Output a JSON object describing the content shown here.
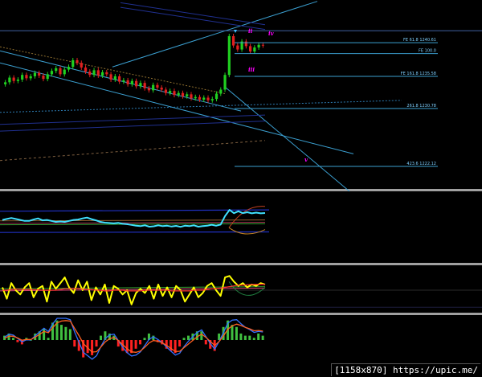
{
  "chart_data": [
    {
      "type": "candlestick",
      "panel": "price",
      "candles_close": [
        1234.7,
        1235.4,
        1234.9,
        1235.1,
        1235.8,
        1235.3,
        1235.6,
        1236.1,
        1235.7,
        1235.2,
        1235.9,
        1236.4,
        1236.8,
        1235.9,
        1236.6,
        1237.0,
        1238.0,
        1237.6,
        1236.9,
        1236.3,
        1235.8,
        1236.5,
        1235.7,
        1236.2,
        1235.9,
        1235.1,
        1235.6,
        1234.8,
        1235.0,
        1234.4,
        1234.9,
        1234.1,
        1234.6,
        1233.8,
        1233.5,
        1234.3,
        1233.9,
        1233.6,
        1233.1,
        1233.4,
        1232.8,
        1233.1,
        1232.6,
        1232.9,
        1232.3,
        1232.5,
        1232.1,
        1232.4,
        1232.0,
        1232.2,
        1233.0,
        1233.6,
        1235.8,
        1241.6,
        1240.2,
        1239.6,
        1240.8,
        1240.1,
        1239.3,
        1239.9,
        1240.3,
        1240.2
      ],
      "levels": [
        {
          "label": "FE 61.8 1240.61",
          "value": 1240.61
        },
        {
          "label": "FE 100.0",
          "value": 1239.0
        },
        {
          "label": "FE 161.8 1235.58",
          "value": 1235.58
        },
        {
          "label": "261.8 1230.78",
          "value": 1230.78
        },
        {
          "label": "423.6 1222.12",
          "value": 1222.12
        }
      ],
      "wave_labels": [
        {
          "text": "ii",
          "color": "#ff00ff"
        },
        {
          "text": "iii",
          "color": "#ff00ff"
        },
        {
          "text": "iv",
          "color": "#ff00ff"
        },
        {
          "text": "v",
          "color": "#ff00ff"
        }
      ],
      "ylim": [
        1219,
        1247
      ]
    },
    {
      "type": "line",
      "panel": "oscillator-1",
      "series": [
        {
          "color": "#40e0ff",
          "values": [
            0.1,
            0.15,
            0.2,
            0.15,
            0.1,
            0.05,
            0.05,
            0.12,
            0.18,
            0.08,
            0.1,
            0.05,
            0.0,
            0.02,
            0.0,
            0.05,
            0.1,
            0.12,
            0.18,
            0.22,
            0.14,
            0.08,
            0.0,
            -0.04,
            -0.06,
            -0.08,
            -0.05,
            -0.1,
            -0.12,
            -0.16,
            -0.2,
            -0.22,
            -0.18,
            -0.25,
            -0.23,
            -0.18,
            -0.22,
            -0.2,
            -0.24,
            -0.21,
            -0.26,
            -0.2,
            -0.22,
            -0.18,
            -0.25,
            -0.22,
            -0.2,
            -0.15,
            -0.2,
            -0.14,
            0.3,
            0.62,
            0.45,
            0.55,
            0.45,
            0.5,
            0.44,
            0.48,
            0.44,
            0.46
          ]
        }
      ],
      "ylim": [
        -1,
        1
      ]
    },
    {
      "type": "line",
      "panel": "oscillator-2",
      "series": [
        {
          "color": "#ffff00",
          "values": [
            0.2,
            -0.6,
            0.5,
            0.0,
            -0.3,
            0.2,
            0.5,
            -0.5,
            0.1,
            0.3,
            -0.8,
            0.6,
            0.1,
            0.5,
            0.9,
            0.2,
            -0.2,
            0.7,
            0.0,
            0.6,
            -0.7,
            0.2,
            -0.3,
            0.4,
            -0.9,
            0.3,
            0.1,
            -0.3,
            0.0,
            -1.0,
            -0.2,
            0.1,
            -0.2,
            0.3,
            -0.6,
            0.4,
            -0.4,
            0.2,
            -0.5,
            0.3,
            0.0,
            -0.8,
            -0.3,
            0.2,
            -0.5,
            -0.2,
            0.3,
            0.5,
            0.0,
            -0.4,
            0.9,
            1.0,
            0.6,
            0.3,
            0.5,
            0.2,
            0.4,
            0.3,
            0.5,
            0.4
          ]
        },
        {
          "color": "#ff3030",
          "values": [
            0.0,
            0.0,
            0.05,
            0.08,
            0.06,
            0.05,
            0.06,
            0.04,
            0.02,
            0.0,
            0.0,
            0.0,
            0.0,
            0.05,
            0.1,
            0.1,
            0.12,
            0.12,
            0.08,
            0.05,
            0.05,
            0.0,
            0.0,
            -0.05,
            -0.05,
            0.0,
            0.0,
            0.0,
            -0.05,
            -0.05,
            -0.05,
            -0.05,
            0.0,
            0.0,
            0.0,
            0.0,
            0.0,
            0.0,
            -0.05,
            -0.05,
            -0.05,
            -0.05,
            -0.05,
            0.0,
            0.0,
            0.0,
            0.05,
            0.1,
            0.12,
            0.15,
            0.2,
            0.25,
            0.3,
            0.35,
            0.35,
            0.38,
            0.4,
            0.4,
            0.42,
            0.42
          ]
        }
      ],
      "ylim": [
        -1.3,
        1.3
      ]
    },
    {
      "type": "bar",
      "panel": "histogram",
      "values": [
        0.2,
        0.3,
        0.1,
        -0.1,
        -0.2,
        0.1,
        0.0,
        0.3,
        0.4,
        0.5,
        0.1,
        0.8,
        0.9,
        0.7,
        0.6,
        0.5,
        -0.3,
        -0.5,
        -0.8,
        -0.6,
        -0.7,
        -0.3,
        0.2,
        0.4,
        0.3,
        0.2,
        -0.3,
        -0.5,
        -0.6,
        -0.6,
        -0.4,
        -0.2,
        0.1,
        0.3,
        0.2,
        -0.1,
        -0.2,
        -0.4,
        -0.5,
        -0.6,
        -0.3,
        0.1,
        0.2,
        0.3,
        0.4,
        0.4,
        -0.2,
        -0.4,
        -0.5,
        0.3,
        0.6,
        0.9,
        0.7,
        0.6,
        0.3,
        0.2,
        0.2,
        0.1,
        0.3,
        0.2
      ],
      "colors": {
        "up": "#40c040",
        "down": "#ff2020"
      },
      "ylim": [
        -1,
        1
      ]
    }
  ],
  "footer": {
    "text": "[1158x870] https://upic.me/"
  }
}
